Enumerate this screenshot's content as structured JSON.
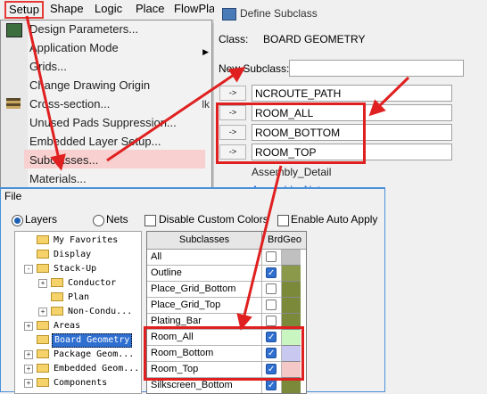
{
  "menubar": {
    "items": [
      "Setup",
      "Shape",
      "Logic",
      "Place",
      "FlowPla"
    ]
  },
  "setup_menu": {
    "items": [
      {
        "label": "Design Parameters...",
        "has_submenu": false
      },
      {
        "label": "Application Mode",
        "has_submenu": true
      },
      {
        "label": "Grids...",
        "has_submenu": false
      },
      {
        "label": "Change Drawing Origin",
        "has_submenu": false
      },
      {
        "label": "Cross-section...",
        "has_submenu": false,
        "shortcut": "lk"
      },
      {
        "label": "Unused Pads Suppression...",
        "has_submenu": false
      },
      {
        "label": "Embedded Layer Setup...",
        "has_submenu": false
      },
      {
        "label": "Subclasses...",
        "has_submenu": false,
        "highlighted": true
      },
      {
        "label": "Materials...",
        "has_submenu": false
      }
    ]
  },
  "define_subclass": {
    "title": "Define Subclass",
    "class_label": "Class:",
    "class_value": "BOARD GEOMETRY",
    "new_subclass_label": "New Subclass:",
    "new_subclass_value": "",
    "arrow_label": "->",
    "rows": [
      "NCROUTE_PATH",
      "ROOM_ALL",
      "ROOM_BOTTOM",
      "ROOM_TOP"
    ],
    "below_text": "Assembly_Detail",
    "below_text_partial": "Assembly_Notes"
  },
  "file_panel": {
    "title": "File",
    "layers_label": "Layers",
    "nets_label": "Nets",
    "disable_colors_label": "Disable Custom Colors",
    "auto_apply_label": "Enable Auto Apply",
    "tree": [
      {
        "label": "My Favorites",
        "expander": ""
      },
      {
        "label": "Display",
        "expander": ""
      },
      {
        "label": "Stack-Up",
        "expander": "-"
      },
      {
        "label": "Conductor",
        "expander": "+"
      },
      {
        "label": "Plan",
        "expander": ""
      },
      {
        "label": "Non-Condu...",
        "expander": "+"
      },
      {
        "label": "Areas",
        "expander": "+"
      },
      {
        "label": "Board Geometry",
        "expander": "",
        "selected": true
      },
      {
        "label": "Package Geom...",
        "expander": "+"
      },
      {
        "label": "Embedded Geom...",
        "expander": "+"
      },
      {
        "label": "Components",
        "expander": "+"
      }
    ],
    "grid": {
      "col_subclasses": "Subclasses",
      "col_brdgeo": "BrdGeo",
      "rows": [
        {
          "name": "All",
          "checked": false,
          "color": "#c0c0c0"
        },
        {
          "name": "Outline",
          "checked": true,
          "color": "#8a9a4a"
        },
        {
          "name": "Place_Grid_Bottom",
          "checked": false,
          "color": "#7a8a3a"
        },
        {
          "name": "Place_Grid_Top",
          "checked": false,
          "color": "#7a8a3a"
        },
        {
          "name": "Plating_Bar",
          "checked": false,
          "color": "#7a8a3a"
        },
        {
          "name": "Room_All",
          "checked": true,
          "color": "#c8f5c0"
        },
        {
          "name": "Room_Bottom",
          "checked": true,
          "color": "#c8c8f0"
        },
        {
          "name": "Room_Top",
          "checked": true,
          "color": "#f5c8c8"
        },
        {
          "name": "Silkscreen_Bottom",
          "checked": true,
          "color": "#7a8a3a"
        }
      ]
    }
  },
  "colors": {
    "annotation_red": "#e02020",
    "selection_blue": "#2f6fd0"
  }
}
